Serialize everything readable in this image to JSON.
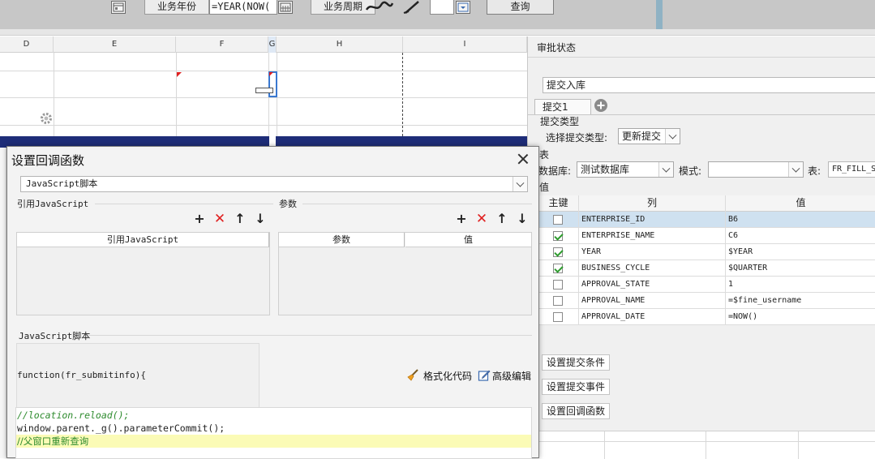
{
  "topbar": {
    "year_label": "业务年份",
    "year_value": "=YEAR(NOW(",
    "period_label": "业务周期",
    "query_button": "查询"
  },
  "sheet": {
    "columns": [
      "D",
      "E",
      "F",
      "G",
      "H",
      "I"
    ]
  },
  "right_panel": {
    "approval_status_label": "审批状态",
    "submit_name_value": "提交入库",
    "submit_tab": "提交1",
    "submit_type_section": "提交类型",
    "choose_submit_type_label": "选择提交类型:",
    "submit_type_value": "更新提交",
    "table_section": "表",
    "database_label": "数据库:",
    "database_value": "测试数据库",
    "schema_label": "模式:",
    "schema_value": "",
    "table_label": "表:",
    "table_value": "FR_FILL_S",
    "value_section": "值",
    "grid_headers": [
      "主键",
      "列",
      "值"
    ],
    "grid_rows": [
      {
        "key": false,
        "column": "ENTERPRISE_ID",
        "value": "B6"
      },
      {
        "key": true,
        "column": "ENTERPRISE_NAME",
        "value": "C6"
      },
      {
        "key": true,
        "column": "YEAR",
        "value": "$YEAR"
      },
      {
        "key": true,
        "column": "BUSINESS_CYCLE",
        "value": "$QUARTER"
      },
      {
        "key": false,
        "column": "APPROVAL_STATE",
        "value": "1"
      },
      {
        "key": false,
        "column": "APPROVAL_NAME",
        "value": "=$fine_username"
      },
      {
        "key": false,
        "column": "APPROVAL_DATE",
        "value": "=NOW()"
      }
    ],
    "buttons": {
      "submit_condition": "设置提交条件",
      "submit_event": "设置提交事件",
      "callback_function": "设置回调函数"
    }
  },
  "dialog": {
    "title": "设置回调函数",
    "type_value": "JavaScript脚本",
    "ref_js_section": "引用JavaScript",
    "params_section": "参数",
    "ref_js_header": "引用JavaScript",
    "param_header": "参数",
    "value_header": "值",
    "script_section": "JavaScript脚本",
    "function_signature": "function(fr_submitinfo){",
    "format_code": "格式化代码",
    "advanced_edit": "高级编辑",
    "code_lines": [
      "//location.reload();",
      "window.parent._g().parameterCommit();",
      "//父窗口重新查询"
    ]
  },
  "colors": {
    "navy_band": "#1e2d78",
    "selected_row": "#cfe1f0",
    "highlight_line": "#fbfbb6",
    "delete_red": "#e02020",
    "checkbox_green": "#2e9b2e"
  }
}
